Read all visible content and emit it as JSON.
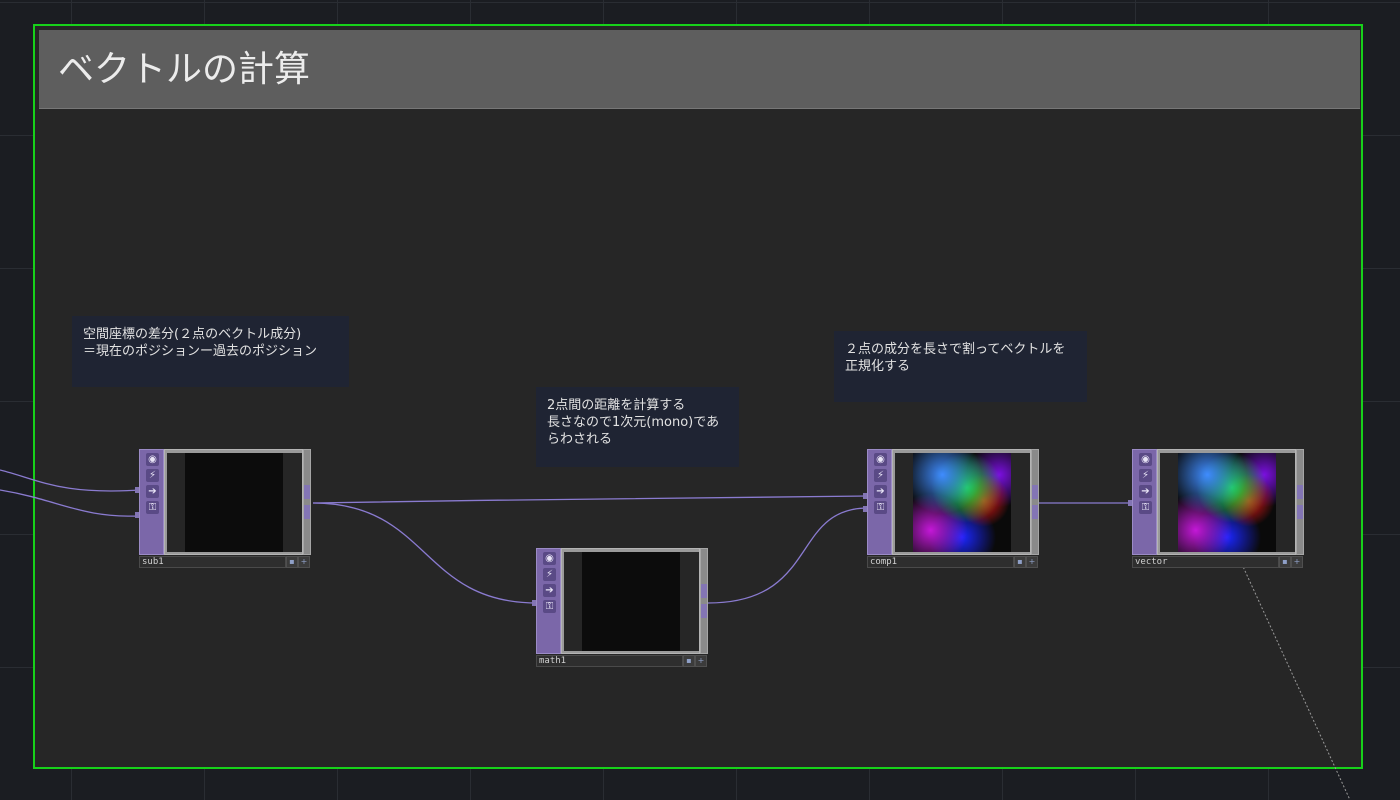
{
  "annotation": {
    "title": "ベクトルの計算",
    "border_color": "#17d11a"
  },
  "comments": [
    {
      "id": "c1",
      "text": "空間座標の差分(２点のベクトル成分)\n＝現在のポジションー過去のポジション"
    },
    {
      "id": "c2",
      "text": "2点間の距離を計算する\n長さなので1次元(mono)であ\nらわされる"
    },
    {
      "id": "c3",
      "text": "２点の成分を長さで割ってベクトルを\n正規化する"
    }
  ],
  "nodes": [
    {
      "id": "sub1",
      "label": "sub1",
      "preview": "dark"
    },
    {
      "id": "math1",
      "label": "math1",
      "preview": "dark"
    },
    {
      "id": "comp1",
      "label": "comp1",
      "preview": "color"
    },
    {
      "id": "vector",
      "label": "vector",
      "preview": "color"
    }
  ],
  "node_buttons": {
    "viewer": "viewer-icon",
    "bypass": "bypass-icon",
    "export": "export-arrow-icon",
    "lock": "lock-icon"
  },
  "colors": {
    "op_family": "#7b67a9",
    "wire": "#8a7bd0",
    "comment_bg": "#1f2433"
  }
}
